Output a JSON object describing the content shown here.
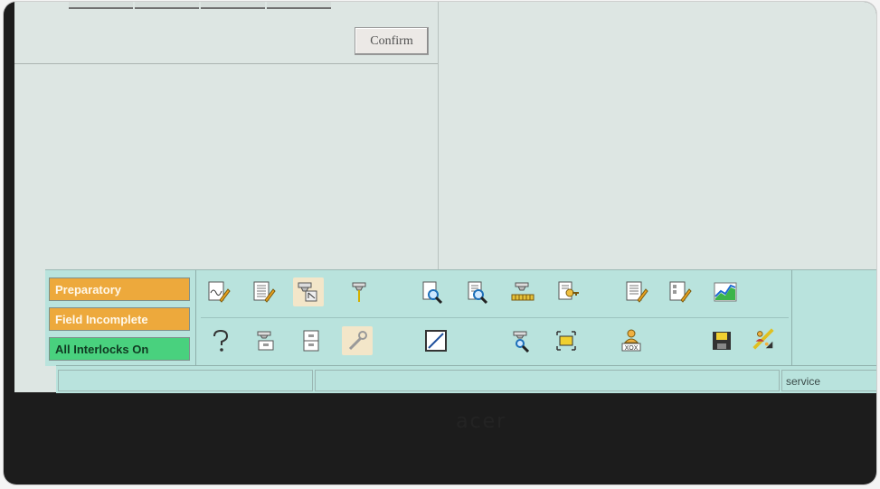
{
  "dialog": {
    "confirm_label": "Confirm"
  },
  "status": {
    "items": [
      {
        "label": "Preparatory",
        "color": "#eda93c"
      },
      {
        "label": "Field Incomplete",
        "color": "#eda93c"
      },
      {
        "label": "All Interlocks On",
        "color": "#49d17e"
      }
    ]
  },
  "toolbar": {
    "row1_icons": [
      "waveform-edit-icon",
      "table-edit-icon",
      "beam-select-icon",
      "beam-icon",
      "document-search-icon",
      "list-search-icon",
      "collimator-icon",
      "document-key-icon",
      "list-edit-icon",
      "sheet-edit-icon",
      "chart-icon"
    ],
    "row2_icons": [
      "help-icon",
      "tray-icon",
      "cabinet-icon",
      "wrench-icon",
      "graph-icon",
      "beam-search-icon",
      "target-icon",
      "patient-xox-icon",
      "save-icon",
      "user-chart-icon"
    ]
  },
  "footer": {
    "mode_label": "service"
  },
  "bezel": {
    "brand": "acer"
  }
}
